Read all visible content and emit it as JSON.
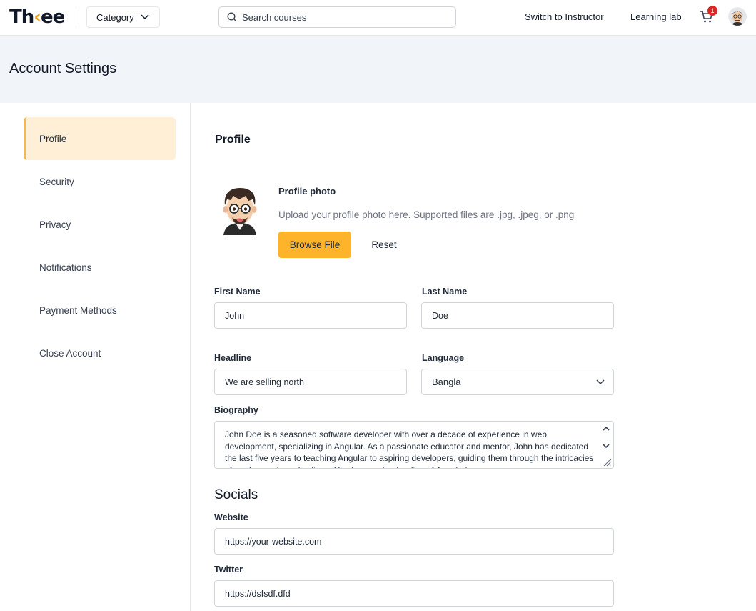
{
  "nav": {
    "logo_prefix": "Th",
    "logo_mark": "‹",
    "logo_suffix": "ee",
    "category_label": "Category",
    "search_placeholder": "Search courses",
    "switch_instructor": "Switch to Instructor",
    "learning_lab": "Learning lab",
    "cart_count": "1"
  },
  "page": {
    "title": "Account Settings"
  },
  "sidebar": {
    "items": [
      {
        "label": "Profile",
        "active": true
      },
      {
        "label": "Security"
      },
      {
        "label": "Privacy"
      },
      {
        "label": "Notifications"
      },
      {
        "label": "Payment Methods"
      },
      {
        "label": "Close Account"
      }
    ]
  },
  "profile": {
    "title": "Profile",
    "photo_label": "Profile photo",
    "photo_help": "Upload your profile photo here. Supported files are .jpg, .jpeg, or .png",
    "browse_label": "Browse File",
    "reset_label": "Reset",
    "first_name": {
      "label": "First Name",
      "value": "John"
    },
    "last_name": {
      "label": "Last Name",
      "value": "Doe"
    },
    "headline": {
      "label": "Headline",
      "value": "We are selling north"
    },
    "language": {
      "label": "Language",
      "value": "Bangla"
    },
    "biography": {
      "label": "Biography",
      "value": "John Doe is a seasoned software developer with over a decade of experience in web development, specializing in Angular. As a passionate educator and mentor, John has dedicated the last five years to teaching Angular to aspiring developers, guiding them through the intricacies of modern web applications. His deep understanding of Angular's"
    }
  },
  "socials": {
    "title": "Socials",
    "website": {
      "label": "Website",
      "value": "https://your-website.com"
    },
    "twitter": {
      "label": "Twitter",
      "value": "https://dsfsdf.dfd"
    }
  },
  "colors": {
    "accent": "#fdb32a",
    "active_bg": "#feefd6",
    "header_bg": "#f1f4f8",
    "badge": "#dc2626"
  }
}
